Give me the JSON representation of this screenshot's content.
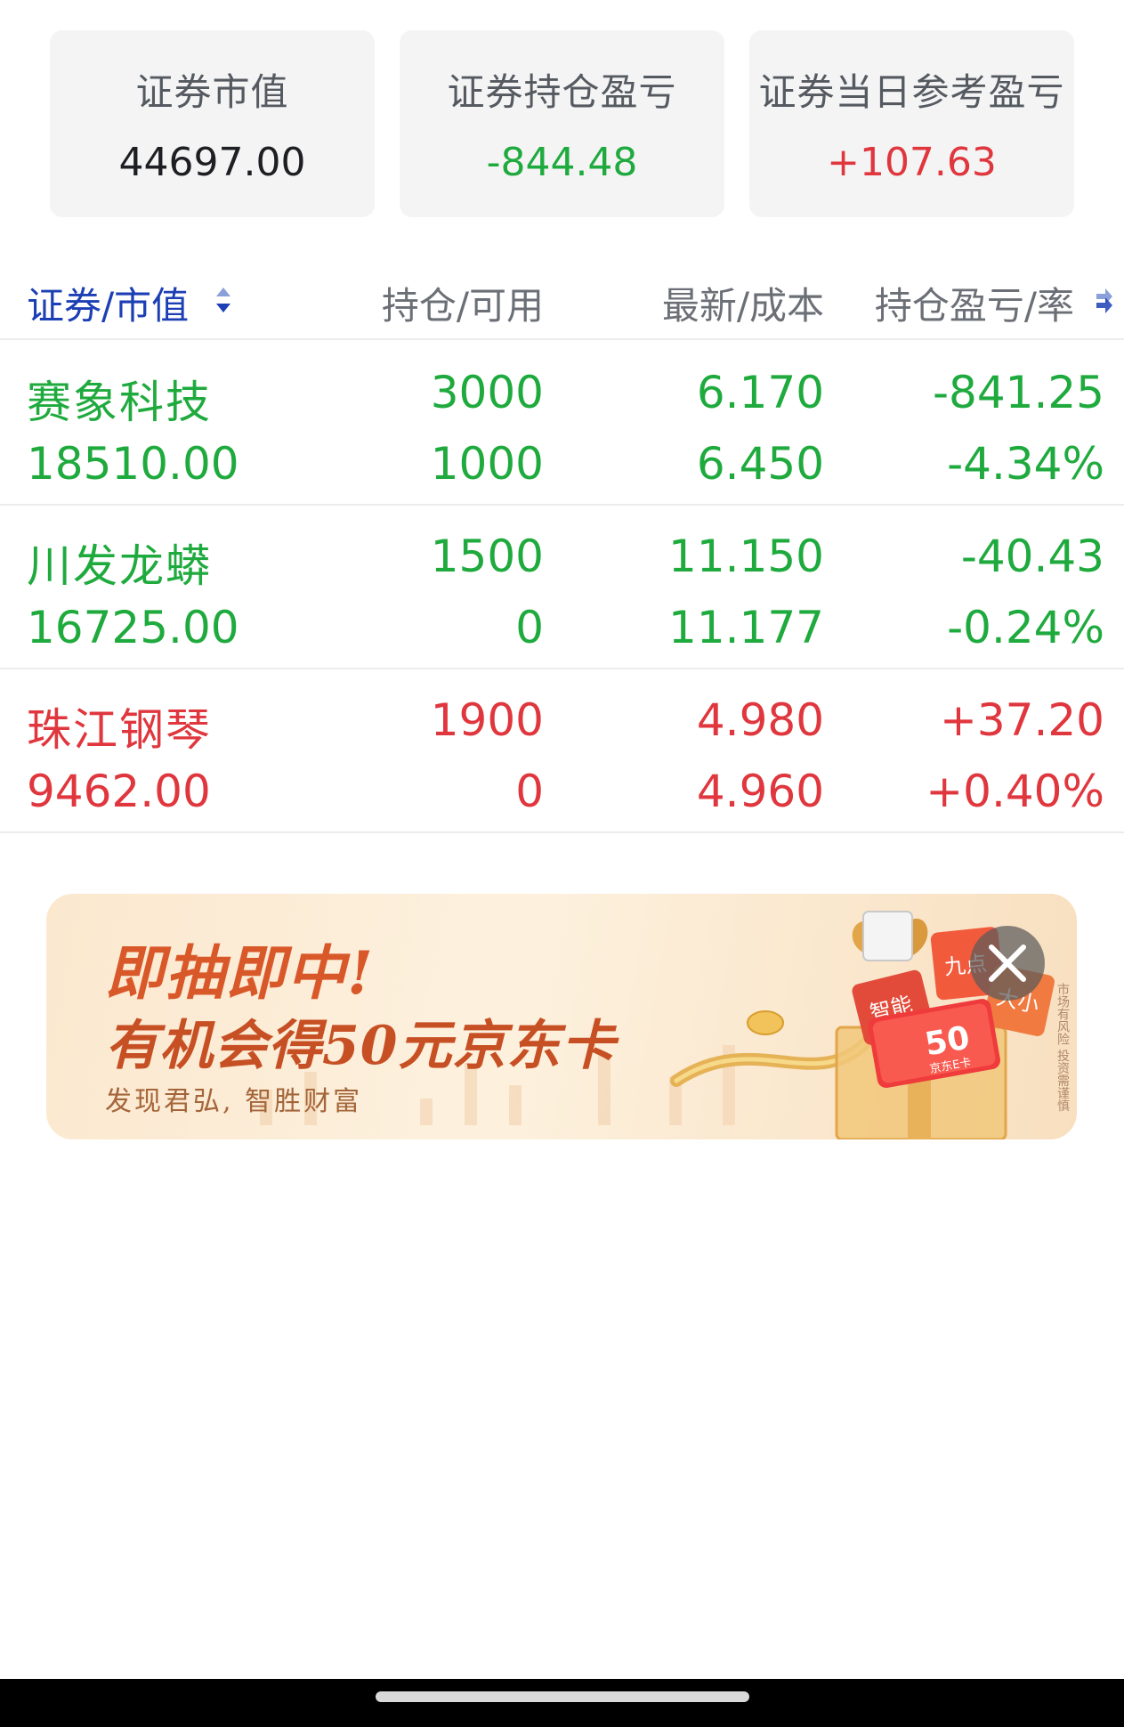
{
  "summary": [
    {
      "label": "证券市值",
      "value": "44697.00",
      "color": "#1e1f22"
    },
    {
      "label": "证券持仓盈亏",
      "value": "-844.48",
      "color": "#1faa3e"
    },
    {
      "label": "证券当日参考盈亏",
      "value": "+107.63",
      "color": "#e0363d"
    }
  ],
  "table": {
    "headers": {
      "security": "证券/市值",
      "position": "持仓/可用",
      "price": "最新/成本",
      "pl": "持仓盈亏/率"
    },
    "rows": [
      {
        "name": "赛象科技",
        "market_value": "18510.00",
        "holding": "3000",
        "available": "1000",
        "latest": "6.170",
        "cost": "6.450",
        "pl": "-841.25",
        "pl_rate": "-4.34%",
        "color": "#1faa3e"
      },
      {
        "name": "川发龙蟒",
        "market_value": "16725.00",
        "holding": "1500",
        "available": "0",
        "latest": "11.150",
        "cost": "11.177",
        "pl": "-40.43",
        "pl_rate": "-0.24%",
        "color": "#1faa3e"
      },
      {
        "name": "珠江钢琴",
        "market_value": "9462.00",
        "holding": "1900",
        "available": "0",
        "latest": "4.980",
        "cost": "4.960",
        "pl": "+37.20",
        "pl_rate": "+0.40%",
        "color": "#e0363d"
      }
    ]
  },
  "banner": {
    "title1": "即抽即中!",
    "title2": "有机会得50元京东卡",
    "subtitle": "发现君弘, 智胜财富",
    "card_amount": "50",
    "card_label": "京东E卡",
    "side_note": "市场有风险 投资需谨慎"
  },
  "colors": {
    "up": "#e0363d",
    "down": "#1faa3e",
    "accent": "#1d3fb5"
  }
}
